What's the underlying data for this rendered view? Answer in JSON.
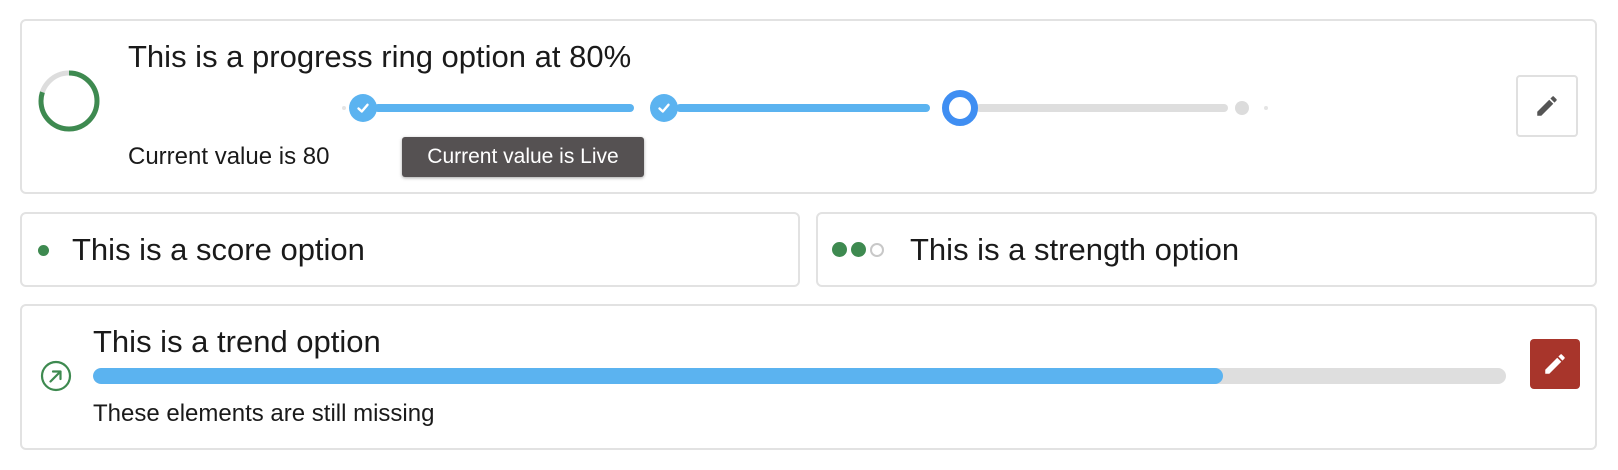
{
  "ring_card": {
    "title": "This is a progress ring option at 80%",
    "subtitle": "Current value is 80",
    "progress_percent": 80,
    "ring_color": "#3e8a50",
    "tooltip": "Current value is Live",
    "steps": [
      {
        "state": "done"
      },
      {
        "state": "done"
      },
      {
        "state": "current"
      },
      {
        "state": "todo"
      }
    ],
    "edit_icon": "pencil-icon"
  },
  "score_card": {
    "label": "This is a score option",
    "indicator_color": "#3e8a50"
  },
  "strength_card": {
    "label": "This is a strength option",
    "level": 2,
    "max_level": 3
  },
  "trend_card": {
    "title": "This is a trend option",
    "subtitle": "These elements are still missing",
    "progress_fraction": 0.8,
    "icon": "trend-arrow-up-right-icon",
    "edit_icon": "pencil-icon",
    "edit_button_color": "#a8352b"
  },
  "colors": {
    "accent_blue": "#5bb3f0",
    "current_step_blue": "#3f8ef2",
    "green": "#3e8a50"
  }
}
